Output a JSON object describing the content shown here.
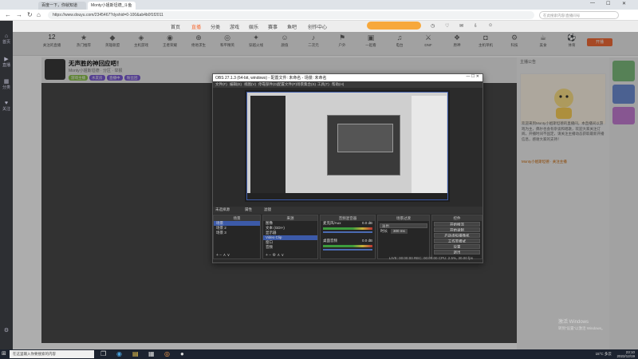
{
  "browser": {
    "tabs": [
      {
        "label": "百度一下，你就知道"
      },
      {
        "label": "Monty小姐斯坦德_斗鱼"
      }
    ],
    "url": "https://www.douyu.com/2345467?dyshid=0-100&ab4b0f1f2011",
    "search_placeholder": "在此搜索内容/直播间号",
    "window_controls": [
      "—",
      "☐",
      "✕"
    ]
  },
  "left_rail": {
    "items": [
      {
        "icon": "home-icon",
        "glyph": "⌂",
        "label": "首页"
      },
      {
        "icon": "live-icon",
        "glyph": "▶",
        "label": "直播"
      },
      {
        "icon": "category-icon",
        "glyph": "▦",
        "label": "分类"
      },
      {
        "icon": "follow-icon",
        "glyph": "♥",
        "label": "关注"
      }
    ],
    "bottom_icon": "settings-icon"
  },
  "site_header": {
    "nav": [
      "首页",
      "直播",
      "分类",
      "游戏",
      "娱乐",
      "赛事",
      "鱼吧",
      "创作中心"
    ],
    "right_icons": [
      "history-icon",
      "follow-icon",
      "message-icon",
      "download-icon",
      "user-icon"
    ]
  },
  "category_bar": {
    "featured_count": "12",
    "featured_label": "关注的直播",
    "items": [
      {
        "label": "热门推荐",
        "glyph": "★"
      },
      {
        "label": "英雄联盟",
        "glyph": "◆"
      },
      {
        "label": "主机游戏",
        "glyph": "◈"
      },
      {
        "label": "王者荣耀",
        "glyph": "◉"
      },
      {
        "label": "绝地求生",
        "glyph": "⊕"
      },
      {
        "label": "和平精英",
        "glyph": "◎"
      },
      {
        "label": "穿越火线",
        "glyph": "✦"
      },
      {
        "label": "颜值",
        "glyph": "☺"
      },
      {
        "label": "二次元",
        "glyph": "♪"
      },
      {
        "label": "户外",
        "glyph": "⚑"
      },
      {
        "label": "一起看",
        "glyph": "▣"
      },
      {
        "label": "电台",
        "glyph": "♫"
      },
      {
        "label": "DNF",
        "glyph": "⚔"
      },
      {
        "label": "原神",
        "glyph": "❖"
      },
      {
        "label": "主机单机",
        "glyph": "◘"
      },
      {
        "label": "科技",
        "glyph": "⚙"
      },
      {
        "label": "美食",
        "glyph": "☕"
      },
      {
        "label": "体育",
        "glyph": "⚽"
      }
    ],
    "live_button": "开播"
  },
  "room": {
    "title": "无声胜的神回应吧！",
    "meta": "Monty小姐斯坦德 · 分区 · 举报",
    "tags": [
      {
        "label": "游戏主播",
        "color": "#8bc34a"
      },
      {
        "label": "水友房",
        "color": "#7c5cd6"
      },
      {
        "label": "直播中",
        "color": "#7c5cd6"
      },
      {
        "label": "粉丝团",
        "color": "#7c5cd6"
      }
    ]
  },
  "obs": {
    "title": "OBS 27.1.3 (64-bit, windows) - 配置文件: 未命名 - 场景: 未命名",
    "menu": [
      "文件(F)",
      "编辑(E)",
      "视图(V)",
      "停靠部件(D)",
      "配置文件(P)",
      "场景集合(S)",
      "工具(T)",
      "帮助(H)"
    ],
    "scene_bar": [
      "未选择源",
      "属性",
      "滤镜"
    ],
    "docks": {
      "scenes": {
        "title": "场景",
        "items": [
          "场景",
          "场景 2",
          "场景 3"
        ]
      },
      "sources": {
        "title": "来源",
        "items": [
          "图像",
          "文本 (GDI+)",
          "显示器",
          "Video Clip",
          "窗口",
          "音频"
        ]
      },
      "mixer": {
        "title": "音频混音器",
        "channels": [
          {
            "name": "麦克风/Aux",
            "db": "0.0 dB"
          },
          {
            "name": "桌面音频",
            "db": "0.0 dB"
          }
        ]
      },
      "transitions": {
        "title": "场景过渡",
        "type": "淡出",
        "duration_label": "时长",
        "duration": "300 ms"
      },
      "controls": {
        "title": "控件",
        "buttons": [
          "开始推流",
          "开始录制",
          "启动虚拟摄像机",
          "工作室模式",
          "设置",
          "退出"
        ]
      }
    },
    "status": "LIVE: 00:00:00   REC: 00:00:00   CPU: 2.5%, 30.00 fps"
  },
  "right_panel": {
    "header": "主播公告",
    "announcement": "欢迎来到Monty小姐斯坦德的直播间，本直播间以游戏为主，偶尔也会有杂谈和唱歌，欢迎大家关注订阅，开播时间不固定，请关注主播动态获取最新开播信息，感谢大家的支持！",
    "link": "Monty小姐斯坦德 · 关注主播"
  },
  "taskbar": {
    "search": "在这里输入你要搜索的内容",
    "apps": [
      "task-view-icon",
      "edge-icon",
      "file-explorer-icon",
      "store-icon",
      "chrome-icon",
      "obs-icon"
    ],
    "weather": "15°C 多云",
    "time": "23:10",
    "date": "2022/12/19"
  },
  "watermark": {
    "line1": "激活 Windows",
    "line2": "转到“设置”以激活 Windows。"
  }
}
